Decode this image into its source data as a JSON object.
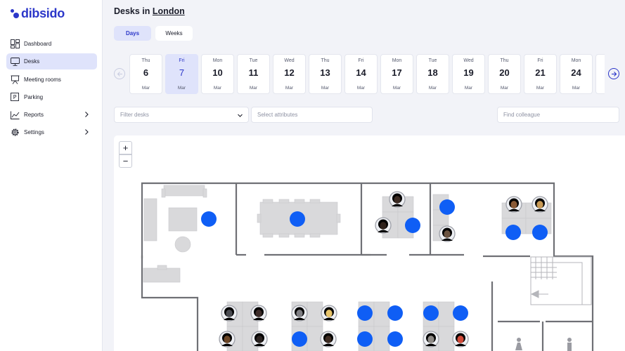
{
  "app": {
    "logo_text": "dibsido",
    "brand_color": "#2c37c9"
  },
  "sidebar": {
    "items": [
      {
        "label": "Dashboard",
        "icon": "dashboard-icon"
      },
      {
        "label": "Desks",
        "icon": "desk-monitor-icon",
        "active": true
      },
      {
        "label": "Meeting rooms",
        "icon": "presentation-board-icon"
      },
      {
        "label": "Parking",
        "icon": "parking-icon"
      },
      {
        "label": "Reports",
        "icon": "chart-trend-icon",
        "has_submenu": true
      },
      {
        "label": "Settings",
        "icon": "gear-icon",
        "has_submenu": true
      }
    ]
  },
  "header": {
    "title_prefix": "Desks in",
    "city": "London"
  },
  "view_toggle": {
    "days_label": "Days",
    "weeks_label": "Weeks",
    "selected": "Days"
  },
  "dates": [
    {
      "dow": "Thu",
      "day": "6",
      "month": "Mar"
    },
    {
      "dow": "Fri",
      "day": "7",
      "month": "Mar",
      "selected": true
    },
    {
      "dow": "Mon",
      "day": "10",
      "month": "Mar"
    },
    {
      "dow": "Tue",
      "day": "11",
      "month": "Mar"
    },
    {
      "dow": "Wed",
      "day": "12",
      "month": "Mar"
    },
    {
      "dow": "Thu",
      "day": "13",
      "month": "Mar"
    },
    {
      "dow": "Fri",
      "day": "14",
      "month": "Mar"
    },
    {
      "dow": "Mon",
      "day": "17",
      "month": "Mar"
    },
    {
      "dow": "Tue",
      "day": "18",
      "month": "Mar"
    },
    {
      "dow": "Wed",
      "day": "19",
      "month": "Mar"
    },
    {
      "dow": "Thu",
      "day": "20",
      "month": "Mar"
    },
    {
      "dow": "Fri",
      "day": "21",
      "month": "Mar"
    },
    {
      "dow": "Mon",
      "day": "24",
      "month": "Mar"
    },
    {
      "dow": "",
      "day": "",
      "month": ""
    }
  ],
  "filters": {
    "filter_desks_placeholder": "Filter desks",
    "select_attributes_placeholder": "Select attributes",
    "find_colleague_placeholder": "Find colleague"
  },
  "map": {
    "zoom_in_label": "+",
    "zoom_out_label": "−",
    "available_desk_color": "#0f5ef5"
  }
}
